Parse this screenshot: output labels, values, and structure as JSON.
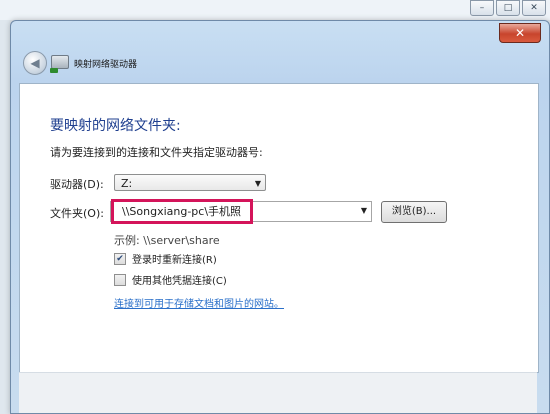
{
  "window": {
    "title": "映射网络驱动器",
    "close_label": "✕"
  },
  "outer_controls": {
    "minimize": "–",
    "maximize": "□",
    "close": "✕"
  },
  "dialog": {
    "heading": "要映射的网络文件夹:",
    "instruction": "请为要连接到的连接和文件夹指定驱动器号:",
    "drive_label": "驱动器(D):",
    "drive_value": "Z:",
    "folder_label": "文件夹(O):",
    "folder_value": "\\\\Songxiang-pc\\手机照",
    "browse_label": "浏览(B)...",
    "example": "示例: \\\\server\\share",
    "reconnect_label": "登录时重新连接(R)",
    "reconnect_checked": true,
    "other_credentials_label": "使用其他凭据连接(C)",
    "other_credentials_checked": false,
    "link_text": "连接到可用于存储文档和图片的网站。"
  },
  "colors": {
    "highlight_border": "#d4145a",
    "heading": "#1f3f8f",
    "link": "#2a6fc9"
  }
}
